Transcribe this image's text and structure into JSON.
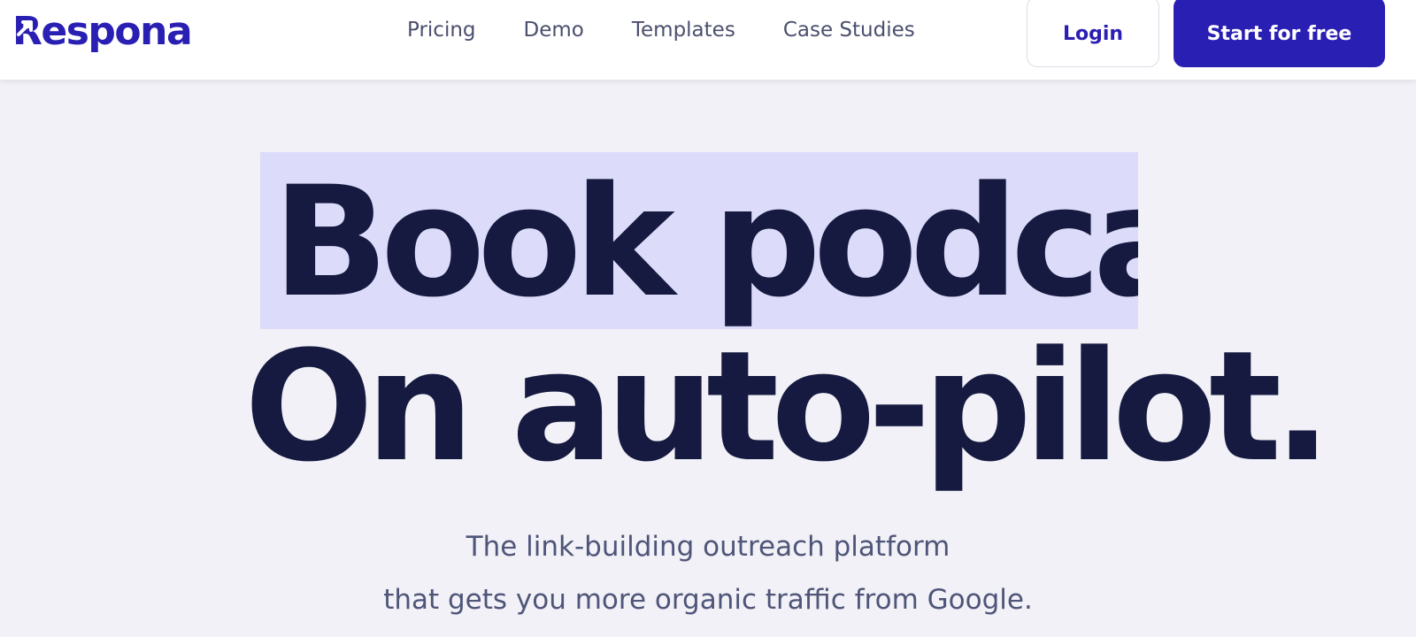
{
  "brand": {
    "logo_text": "Respona",
    "logo_color": "#2a1fb3"
  },
  "nav": {
    "items": [
      {
        "label": "Pricing"
      },
      {
        "label": "Demo"
      },
      {
        "label": "Templates"
      },
      {
        "label": "Case Studies"
      }
    ]
  },
  "header_actions": {
    "login_label": "Login",
    "start_label": "Start for free"
  },
  "hero": {
    "line1": "Book podcas",
    "line2": "On auto-pilot.",
    "highlight_color": "#dcdcfa",
    "text_color": "#161a40"
  },
  "subtitle": {
    "line1": "The link-building outreach platform",
    "line2": "that gets you more organic traffic from Google."
  },
  "colors": {
    "accent": "#2a1fb3",
    "background": "#f1f1f7",
    "nav_text": "#4b4f6e"
  },
  "icons": {
    "logo_arrow": "arrow-up-right-icon"
  }
}
